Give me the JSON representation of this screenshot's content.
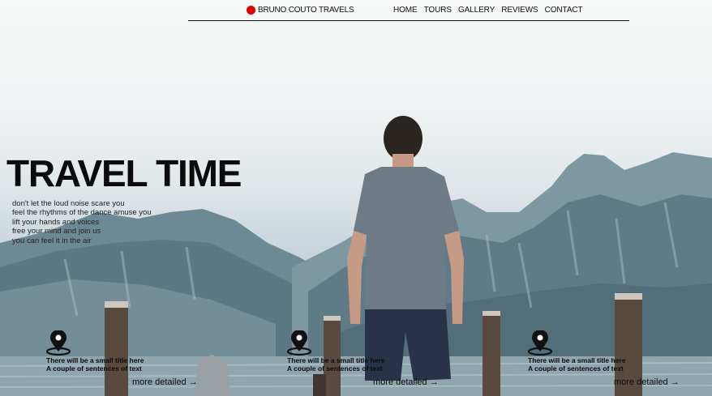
{
  "nav": {
    "brand": "BRUNO COUTO TRAVELS",
    "items": [
      "HOME",
      "TOURS",
      "GALLERY",
      "REVIEWS",
      "CONTACT"
    ]
  },
  "hero": {
    "title": "TRAVEL TIME",
    "lines": [
      "don't let the loud noise scare you",
      "feel the rhythms of the dance amuse you",
      "lift your hands and voices",
      "free your mind and join us",
      "you can feel it in the air"
    ]
  },
  "features": [
    {
      "title": "There will be a small title here",
      "subtitle": "A couple of sentences of text",
      "link": "more detailed →"
    },
    {
      "title": "There will be a small title here",
      "subtitle": "A couple of sentences of text",
      "link": "more detailed →"
    },
    {
      "title": "There will be a small title here",
      "subtitle": "A couple of sentences of text",
      "link": "more detailed →"
    }
  ],
  "colors": {
    "brand_dot": "#e10000",
    "text": "#111111"
  },
  "icons": [
    "location-pin-icon"
  ]
}
